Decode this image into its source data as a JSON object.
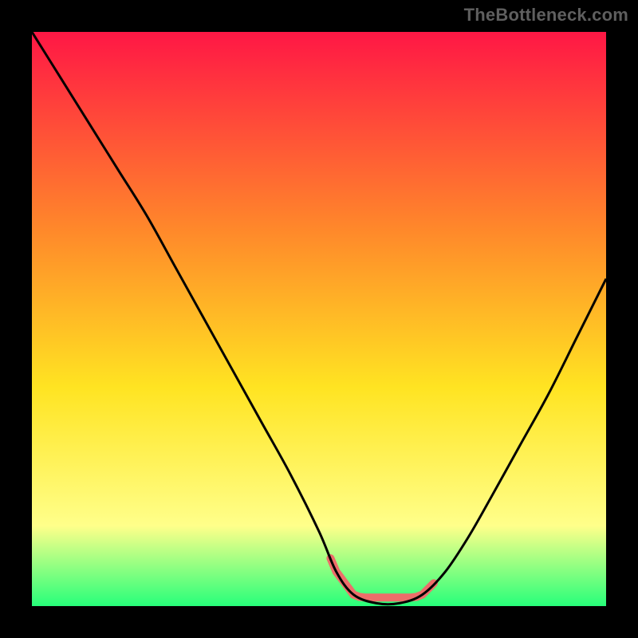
{
  "attribution": "TheBottleneck.com",
  "colors": {
    "page_bg": "#000000",
    "grad_top": "#ff1745",
    "grad_mid1": "#ff8a2a",
    "grad_mid2": "#ffe422",
    "grad_low": "#ffff8a",
    "grad_bottom": "#27ff7a",
    "curve": "#000000",
    "red_strip": "#ed6d6a"
  },
  "chart_data": {
    "type": "line",
    "title": "",
    "xlabel": "",
    "ylabel": "",
    "xlim": [
      0,
      100
    ],
    "ylim": [
      0,
      100
    ],
    "grid": false,
    "legend": false,
    "series": [
      {
        "name": "bottleneck-curve",
        "x": [
          0,
          5,
          10,
          15,
          20,
          25,
          30,
          35,
          40,
          45,
          50,
          53,
          56,
          60,
          64,
          68,
          72,
          76,
          80,
          85,
          90,
          95,
          100
        ],
        "values": [
          100,
          92,
          84,
          76,
          68,
          59,
          50,
          41,
          32,
          23,
          13,
          6,
          2,
          0.5,
          0.5,
          2,
          6,
          12,
          19,
          28,
          37,
          47,
          57
        ]
      }
    ],
    "annotations": [
      {
        "name": "red-strip",
        "type": "segment",
        "x_range": [
          52,
          70
        ],
        "y": 1.5,
        "thickness_px": 10,
        "color": "#ed6d6a"
      }
    ]
  }
}
